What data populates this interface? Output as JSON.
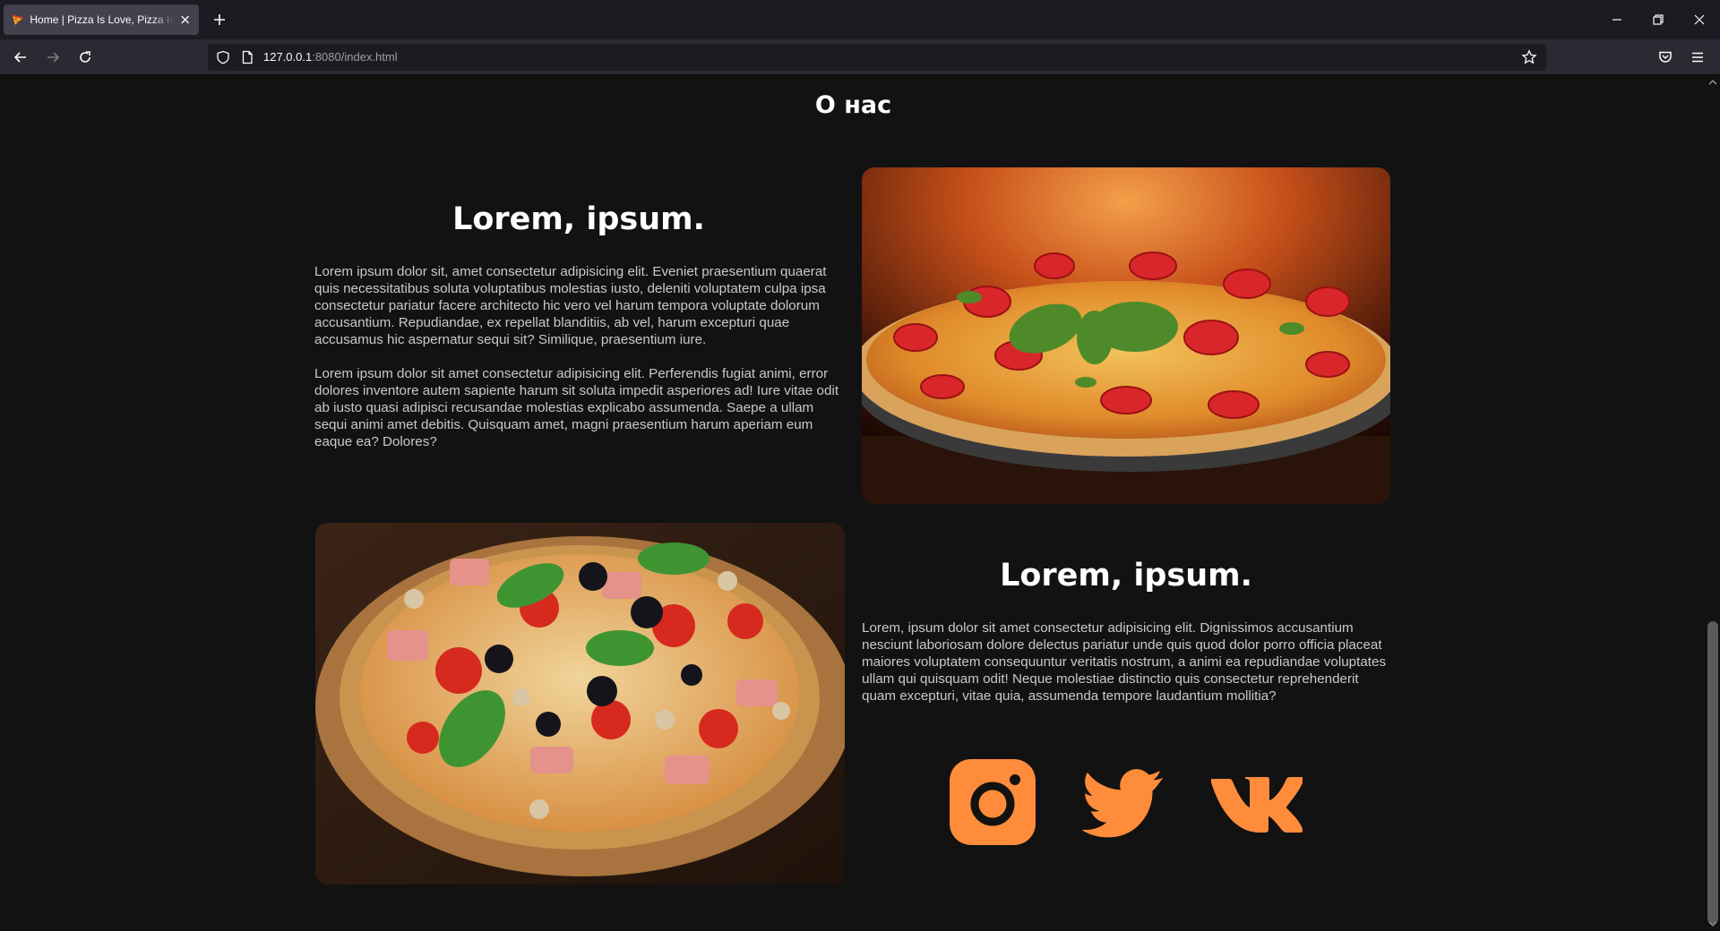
{
  "browser": {
    "tab_title": "Home | Pizza Is Love, Pizza Is Life",
    "url_host": "127.0.0.1",
    "url_rest": ":8080/index.html"
  },
  "page": {
    "section_title": "О нас",
    "block1": {
      "heading": "Lorem, ipsum.",
      "paragraphs": [
        "Lorem ipsum dolor sit, amet consectetur adipisicing elit. Eveniet praesentium quaerat quis necessitatibus soluta voluptatibus molestias iusto, deleniti voluptatem culpa ipsa consectetur pariatur facere architecto hic vero vel harum tempora voluptate dolorum accusantium. Repudiandae, ex repellat blanditiis, ab vel, harum excepturi quae accusamus hic aspernatur sequi sit? Similique, praesentium iure.",
        "Lorem ipsum dolor sit amet consectetur adipisicing elit. Perferendis fugiat animi, error dolores inventore autem sapiente harum sit soluta impedit asperiores ad! Iure vitae odit ab iusto quasi adipisci recusandae molestias explicabo assumenda. Saepe a ullam sequi animi amet debitis. Quisquam amet, magni praesentium harum aperiam eum eaque ea? Dolores?"
      ]
    },
    "block2": {
      "heading": "Lorem, ipsum.",
      "paragraphs": [
        "Lorem, ipsum dolor sit amet consectetur adipisicing elit. Dignissimos accusantium nesciunt laboriosam dolore delectus pariatur unde quis quod dolor porro officia placeat maiores voluptatem consequuntur veritatis nostrum, a animi ea repudiandae voluptates ullam qui quisquam odit! Neque molestiae distinctio quis consectetur reprehenderit quam excepturi, vitae quia, assumenda tempore laudantium mollitia?"
      ]
    },
    "social": {
      "accent_color": "#ff8c3a",
      "icons": [
        "instagram-icon",
        "twitter-icon",
        "vk-icon"
      ]
    }
  }
}
